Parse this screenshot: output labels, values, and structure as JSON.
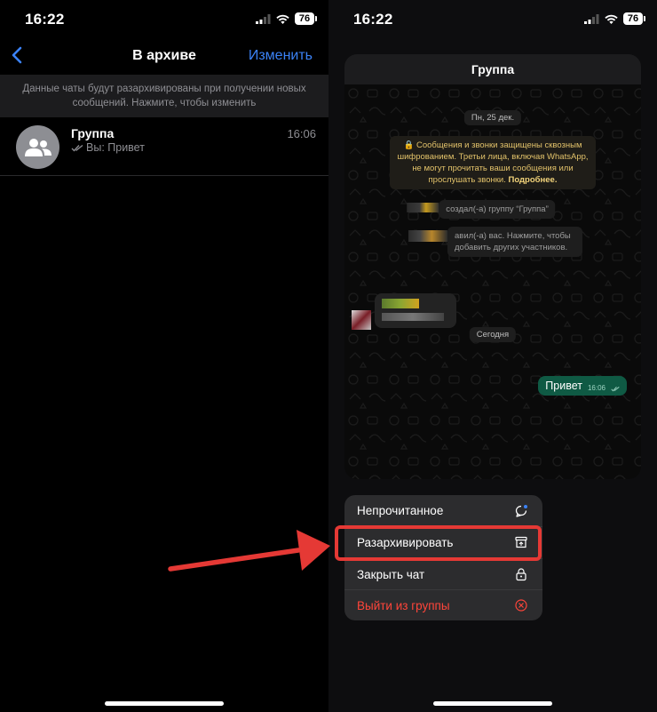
{
  "left": {
    "status": {
      "time": "16:22",
      "battery": "76"
    },
    "nav": {
      "title": "В архиве",
      "edit": "Изменить"
    },
    "notice": "Данные чаты будут разархивированы при получении новых сообщений. Нажмите, чтобы изменить",
    "chat": {
      "name": "Группа",
      "preview": "Вы: Привет",
      "time": "16:06"
    }
  },
  "right": {
    "status": {
      "time": "16:22",
      "battery": "76"
    },
    "chat_title": "Группа",
    "date_header": "Пн, 25 дек.",
    "e2e_notice": {
      "text": "Сообщения и звонки защищены сквозным шифрованием. Третьи лица, включая WhatsApp, не могут прочитать ваши сообщения или прослушать звонки.",
      "link": "Подробнее."
    },
    "system_msg_1": "создал(-а) группу “Группа”",
    "system_msg_2_line1": "авил(-а) вас. Нажмите, чтобы",
    "system_msg_2_line2": "добавить других участников.",
    "today_label": "Сегодня",
    "outgoing_message": {
      "text": "Привет",
      "time": "16:06"
    },
    "menu": [
      {
        "label": "Непрочитанное",
        "icon": "unread-bubble-icon"
      },
      {
        "label": "Разархивировать",
        "icon": "unarchive-box-icon"
      },
      {
        "label": "Закрыть чат",
        "icon": "lock-icon"
      },
      {
        "label": "Выйти из группы",
        "icon": "exit-circle-icon",
        "danger": true
      }
    ]
  },
  "colors": {
    "accent_blue": "#3b82f6",
    "danger_red": "#ff453a",
    "outgoing_green": "#0f5a44",
    "annotation_red": "#e53935"
  }
}
